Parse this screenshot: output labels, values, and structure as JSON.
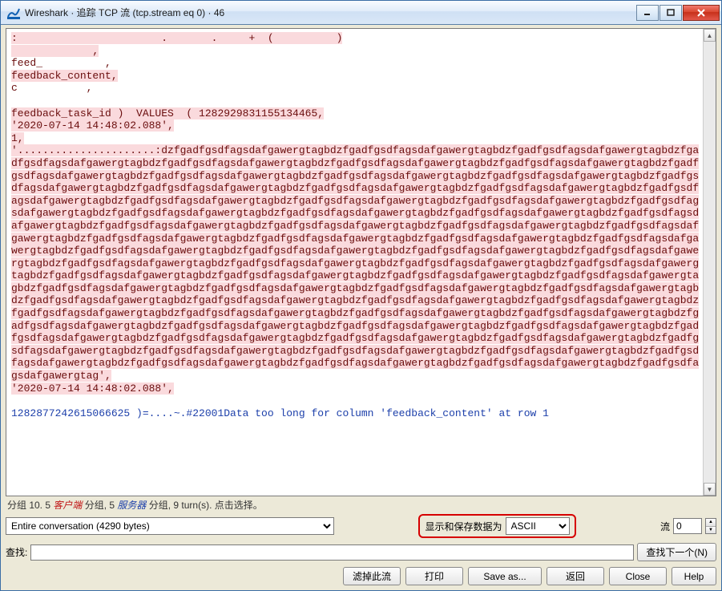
{
  "window": {
    "title": "Wireshark · 追踪 TCP 流 (tcp.stream eq 0) · 46"
  },
  "stream": {
    "line1": ":                       .       .     +  (          )",
    "line2": "             ,",
    "line3": "feed_          ,",
    "line4": "feedback_content,",
    "line5": "c           ,",
    "line6": "",
    "line7a": "feedback_task_id )  VALUES  ( 1282929831155134465,",
    "line7b": "'2020-07-14 14:48:02.088',",
    "line7c": "1,",
    "bigtext": "'......................:dzfgadfgsdfagsdafgawergtagbdzfgadfgsdfagsdafgawergtagbdzfgadfgsdfagsdafgawergtagbdzfgadfgsdfagsdafgawergtagbdzfgadfgsdfagsdafgawergtagbdzfgadfgsdfagsdafgawergtagbdzfgadfgsdfagsdafgawergtagbdzfgadfgsdfagsdafgawergtagbdzfgadfgsdfagsdafgawergtagbdzfgadfgsdfagsdafgawergtagbdzfgadfgsdfagsdafgawergtagbdzfgadfgsdfagsdafgawergtagbdzfgadfgsdfagsdafgawergtagbdzfgadfgsdfagsdafgawergtagbdzfgadfgsdfagsdafgawergtagbdzfgadfgsdfagsdafgawergtagbdzfgadfgsdfagsdafgawergtagbdzfgadfgsdfagsdafgawergtagbdzfgadfgsdfagsdafgawergtagbdzfgadfgsdfagsdafgawergtagbdzfgadfgsdfagsdafgawergtagbdzfgadfgsdfagsdafgawergtagbdzfgadfgsdfagsdafgawergtagbdzfgadfgsdfagsdafgawergtagbdzfgadfgsdfagsdafgawergtagbdzfgadfgsdfagsdafgawergtagbdzfgadfgsdfagsdafgawergtagbdzfgadfgsdfagsdafgawergtagbdzfgadfgsdfagsdafgawergtagbdzfgadfgsdfagsdafgawergtagbdzfgadfgsdfagsdafgawergtagbdzfgadfgsdfagsdafgawergtagbdzfgadfgsdfagsdafgawergtagbdzfgadfgsdfagsdafgawergtagbdzfgadfgsdfagsdafgawergtagbdzfgadfgsdfagsdafgawergtagbdzfgadfgsdfagsdafgawergtagbdzfgadfgsdfagsdafgawergtagbdzfgadfgsdfagsdafgawergtagbdzfgadfgsdfagsdafgawergtagbdzfgadfgsdfagsdafgawergtagbdzfgadfgsdfagsdafgawergtagbdzfgadfgsdfagsdafgawergtagbdzfgadfgsdfagsdafgawergtagbdzfgadfgsdfagsdafgawergtagbdzfgadfgsdfagsdafgawergtagbdzfgadfgsdfagsdafgawergtagbdzfgadfgsdfagsdafgawergtagbdzfgadfgsdfagsdafgawergtagbdzfgadfgsdfagsdafgawergtagbdzfgadfgsdfagsdafgawergtagbdzfgadfgsdfagsdafgawergtagbdzfgadfgsdfagsdafgawergtagbdzfgadfgsdfagsdafgawergtagbdzfgadfgsdfagsdafgawergtagbdzfgadfgsdfagsdafgawergtagbdzfgadfgsdfagsdafgawergtagbdzfgadfgsdfagsdafgawergtagbdzfgadfgsdfagsdafgawergtagbdzfgadfgsdfagsdafgawergtagbdzfgadfgsdfagsdafgawergtagbdzfgadfgsdfagsdafgawergtagbdzfgadfgsdfagsdafgawergtagbdzfgadfgsdfagsdafgawergtagbdzfgadfgsdfagsdafgawergtagbdzfgadfgsdfagsdafgawergtagbdzfgadfgsdfagsdafgawergtagbdzfgadfgsdfagsdafgawergtagbdzfgadfgsdfagsdafgawergtagbdzfgadfgsdfagsdafgawergtagbdzfgadfgsdfagsdafgawergtagbdzfgadfgsdfagsdafgawergtagbdzfgadfgsdfagsdafgawergtag',",
    "endts": "'2020-07-14 14:48:02.088',",
    "server": "1282877242615066625 )=....~.#22001Data too long for column 'feedback_content' at row 1"
  },
  "info": {
    "prefix": "分组 10. 5 ",
    "client_word": "客户端",
    "mid": " 分组, 5 ",
    "server_word": "服务器",
    "suffix": " 分组, 9 turn(s). 点击选择。"
  },
  "controls": {
    "conversation_select": "Entire conversation (4290 bytes)",
    "display_label": "显示和保存数",
    "display_label2": "据为",
    "format_select": "ASCII",
    "stream_label": "流",
    "stream_value": "0",
    "find_label": "查找:",
    "find_next": "查找下一个(N)"
  },
  "buttons": {
    "filter_out": "滤掉此流",
    "print": "打印",
    "save_as": "Save as...",
    "back": "返回",
    "close": "Close",
    "help": "Help"
  }
}
